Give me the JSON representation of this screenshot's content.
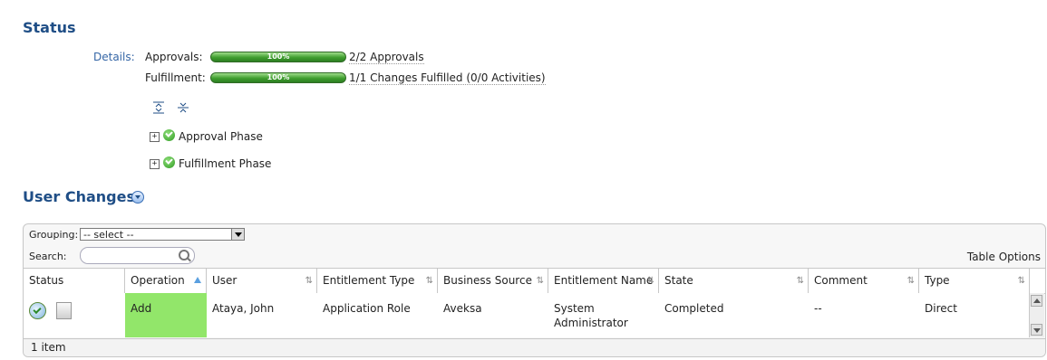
{
  "status": {
    "title": "Status",
    "details_label": "Details:",
    "approvals": {
      "label": "Approvals:",
      "progress_text": "100%",
      "progress": 1.0,
      "summary": "2/2 Approvals"
    },
    "fulfillment": {
      "label": "Fulfillment:",
      "progress_text": "100%",
      "progress": 1.0,
      "summary": "1/1 Changes Fulfilled (0/0 Activities)"
    },
    "phases": [
      {
        "label": "Approval Phase"
      },
      {
        "label": "Fulfillment Phase"
      }
    ]
  },
  "user_changes": {
    "title": "User Changes",
    "grouping_label": "Grouping:",
    "grouping_value": "-- select --",
    "search_label": "Search:",
    "table_options": "Table Options",
    "columns": [
      "Status",
      "Operation",
      "User",
      "Entitlement Type",
      "Business Source",
      "Entitlement Name",
      "State",
      "Comment",
      "Type"
    ],
    "rows": [
      {
        "operation": "Add",
        "user": "Ataya, John",
        "entitlement_type": "Application Role",
        "business_source": "Aveksa",
        "entitlement_name": "System Administrator",
        "state": "Completed",
        "comment": "--",
        "type": "Direct"
      }
    ],
    "footer": "1 item"
  },
  "colors": {
    "heading": "#1f4e86",
    "link": "#3566a6",
    "progress": "#3f9e2f",
    "operation_highlight": "#92e66a"
  }
}
